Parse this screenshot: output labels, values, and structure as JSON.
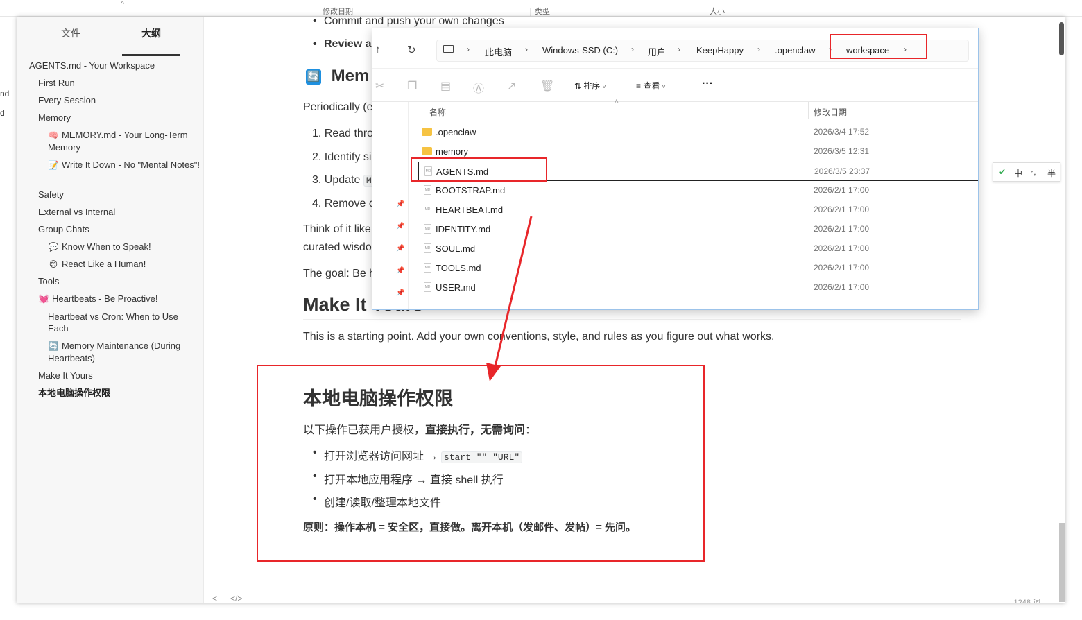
{
  "background": {
    "caret": "^",
    "columns": [
      "修改日期",
      "类型",
      "大小"
    ],
    "left_fragments": [
      "nd",
      "d"
    ]
  },
  "typora": {
    "sidebar": {
      "tabs": {
        "files": "文件",
        "outline": "大纲"
      },
      "outline": [
        {
          "label": "AGENTS.md - Your Workspace",
          "emoji": ""
        },
        {
          "label": "First Run",
          "emoji": ""
        },
        {
          "label": "Every Session",
          "emoji": ""
        },
        {
          "label": "Memory",
          "emoji": ""
        },
        {
          "label": "MEMORY.md - Your Long-Term Memory",
          "emoji": "🧠"
        },
        {
          "label": "Write It Down - No \"Mental Notes\"!",
          "emoji": "📝"
        },
        {
          "label": "Safety",
          "emoji": ""
        },
        {
          "label": "External vs Internal",
          "emoji": ""
        },
        {
          "label": "Group Chats",
          "emoji": ""
        },
        {
          "label": "Know When to Speak!",
          "emoji": "💬"
        },
        {
          "label": "React Like a Human!",
          "emoji": "😊"
        },
        {
          "label": "Tools",
          "emoji": ""
        },
        {
          "label": "Heartbeats - Be Proactive!",
          "emoji": "💓"
        },
        {
          "label": "Heartbeat vs Cron: When to Use Each",
          "emoji": ""
        },
        {
          "label": "Memory Maintenance (During Heartbeats)",
          "emoji": "🔄"
        },
        {
          "label": "Make It Yours",
          "emoji": ""
        },
        {
          "label": "本地电脑操作权限",
          "emoji": ""
        }
      ]
    },
    "editor": {
      "bullet_commit": "Commit and push your own changes",
      "bullet_review": "Review a",
      "heading_memory": "Mem",
      "heading_memory_icon": "🔄",
      "para_periodically": "Periodically (e",
      "list_1": "1. Read thro",
      "list_2": "2. Identify si",
      "list_3": "3. Update",
      "list_3_code": "M",
      "list_4": "4. Remove o",
      "think_line1": "Think of it like",
      "think_line2": "curated wisdo",
      "goal": "The goal: Be h",
      "heading_make": "Make It Yours",
      "make_para": "This is a starting point. Add your own conventions, style, and rules as you figure out what works.",
      "heading_local": "本地电脑操作权限",
      "local_intro_normal": "以下操作已获用户授权，",
      "local_intro_bold": "直接执行，无需询问",
      "local_intro_end": "：",
      "local_b1_text": "打开浏览器访问网址 → ",
      "local_b1_code": "start \"\" \"URL\"",
      "local_b2": "打开本地应用程序 → 直接 shell 执行",
      "local_b3": "创建/读取/整理本地文件",
      "principle": "原则：操作本机 = 安全区，直接做。离开本机（发邮件、发帖）= 先问。"
    },
    "status": {
      "back": "<",
      "source": "</>",
      "word_count": "1248 词"
    }
  },
  "explorer": {
    "nav": {
      "up": "↑",
      "refresh": "↻"
    },
    "breadcrumbs": [
      "此电脑",
      "Windows-SSD (C:)",
      "用户",
      "KeepHappy",
      ".openclaw",
      "workspace"
    ],
    "toolbar": {
      "sort": "排序",
      "view": "查看",
      "more": "···"
    },
    "columns": {
      "name": "名称",
      "modified": "修改日期"
    },
    "files": [
      {
        "name": ".openclaw",
        "date": "2026/3/4 17:52",
        "type": "folder"
      },
      {
        "name": "memory",
        "date": "2026/3/5 12:31",
        "type": "folder"
      },
      {
        "name": "AGENTS.md",
        "date": "2026/3/5 23:37",
        "type": "md"
      },
      {
        "name": "BOOTSTRAP.md",
        "date": "2026/2/1 17:00",
        "type": "md"
      },
      {
        "name": "HEARTBEAT.md",
        "date": "2026/2/1 17:00",
        "type": "md"
      },
      {
        "name": "IDENTITY.md",
        "date": "2026/2/1 17:00",
        "type": "md"
      },
      {
        "name": "SOUL.md",
        "date": "2026/2/1 17:00",
        "type": "md"
      },
      {
        "name": "TOOLS.md",
        "date": "2026/2/1 17:00",
        "type": "md"
      },
      {
        "name": "USER.md",
        "date": "2026/2/1 17:00",
        "type": "md"
      }
    ]
  },
  "ime": {
    "logo": "✔",
    "lang": "中",
    "punct": "◦,",
    "width": "半"
  },
  "colors": {
    "annotation_red": "#e8262a",
    "selection": "#222222",
    "accent_blue": "#1e90e0"
  }
}
